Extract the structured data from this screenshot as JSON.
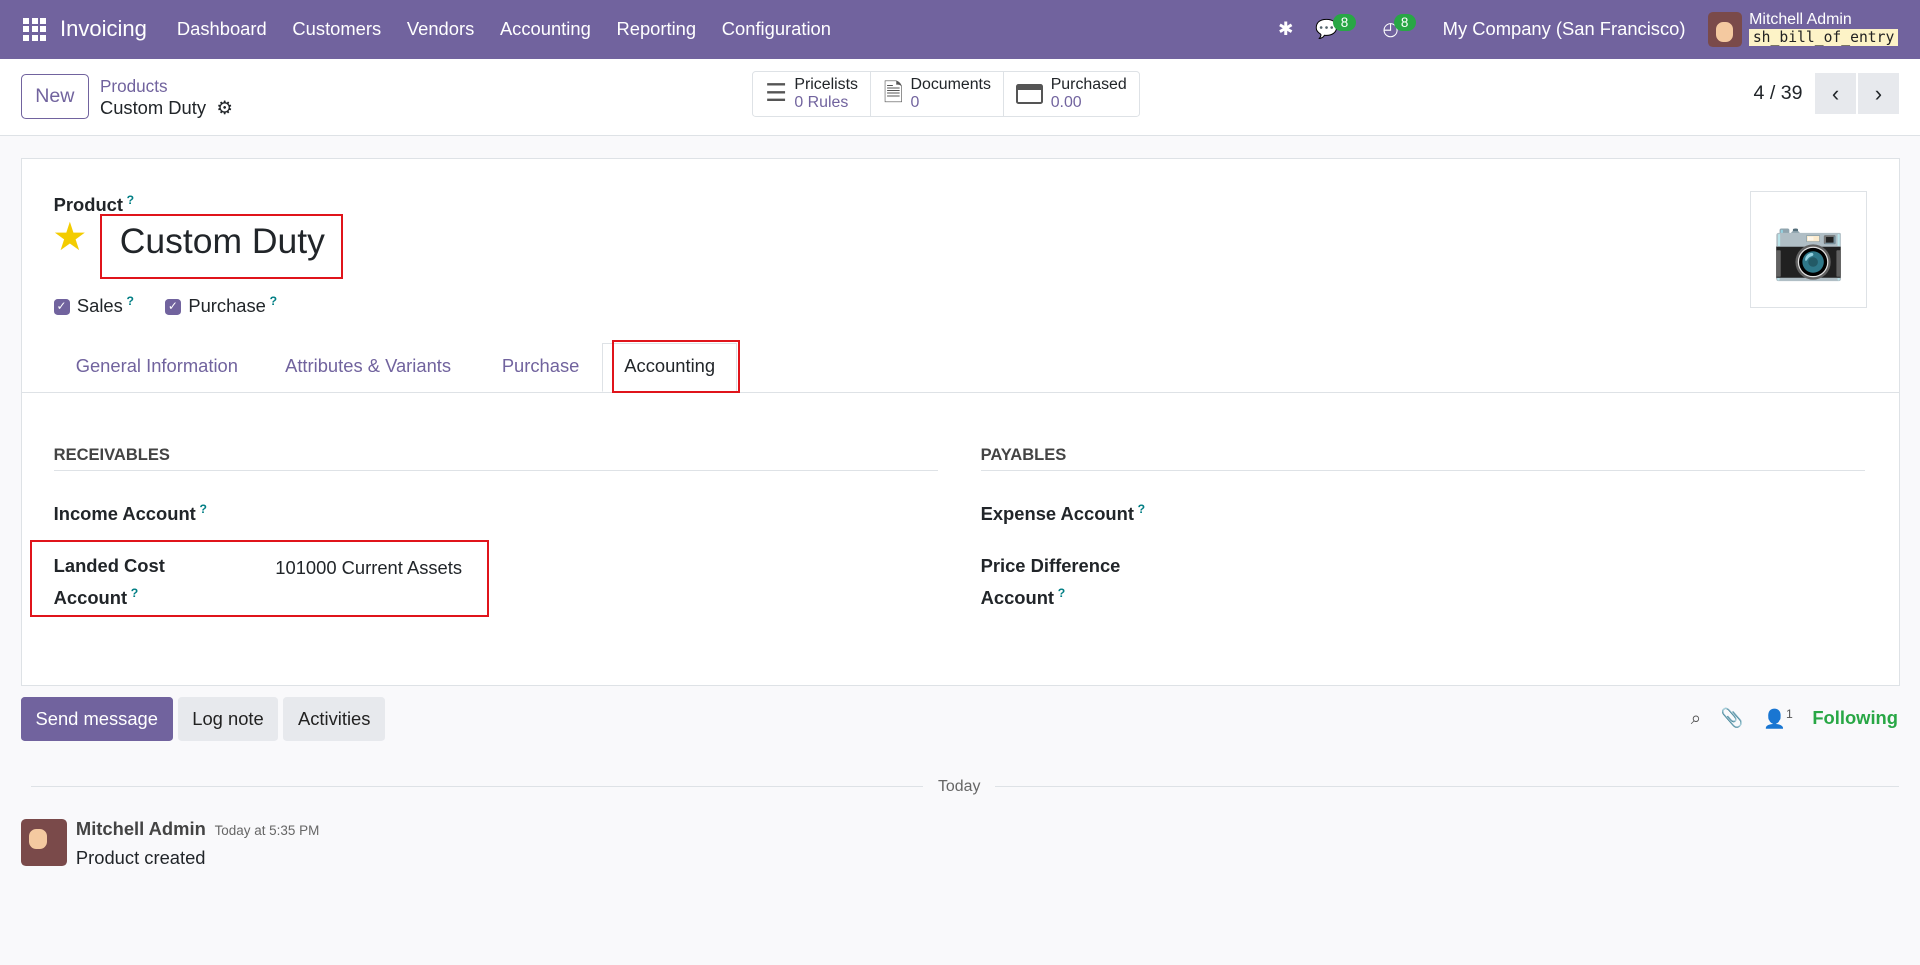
{
  "navbar": {
    "app": "Invoicing",
    "menus": [
      "Dashboard",
      "Customers",
      "Vendors",
      "Accounting",
      "Reporting",
      "Configuration"
    ],
    "messages_count": "8",
    "activities_count": "8",
    "company": "My Company (San Francisco)",
    "user": "Mitchell Admin",
    "database": "sh_bill_of_entry"
  },
  "control": {
    "new_label": "New",
    "breadcrumb_parent": "Products",
    "breadcrumb_current": "Custom Duty",
    "pager": "4 / 39",
    "stats": [
      {
        "label": "Pricelists",
        "value": "0 Rules",
        "icon": "list-icon"
      },
      {
        "label": "Documents",
        "value": "0",
        "icon": "document-icon"
      },
      {
        "label": "Purchased",
        "value": "0.00",
        "icon": "credit-card-icon"
      }
    ]
  },
  "form": {
    "product_label": "Product",
    "name": "Custom Duty",
    "sales_label": "Sales",
    "purchase_label": "Purchase",
    "tabs": [
      "General Information",
      "Attributes & Variants",
      "Purchase",
      "Accounting"
    ],
    "active_tab": "Accounting",
    "receivables_title": "RECEIVABLES",
    "payables_title": "PAYABLES",
    "income_account_label": "Income Account",
    "landed_cost_label_1": "Landed Cost",
    "landed_cost_label_2": "Account",
    "landed_cost_value": "101000 Current Assets",
    "expense_account_label": "Expense Account",
    "price_diff_label_1": "Price Difference",
    "price_diff_label_2": "Account",
    "help": "?"
  },
  "chatter": {
    "send_message": "Send message",
    "log_note": "Log note",
    "activities": "Activities",
    "followers_count": "1",
    "following": "Following",
    "date_separator": "Today",
    "author": "Mitchell Admin",
    "time": "Today at 5:35 PM",
    "body": "Product created"
  }
}
